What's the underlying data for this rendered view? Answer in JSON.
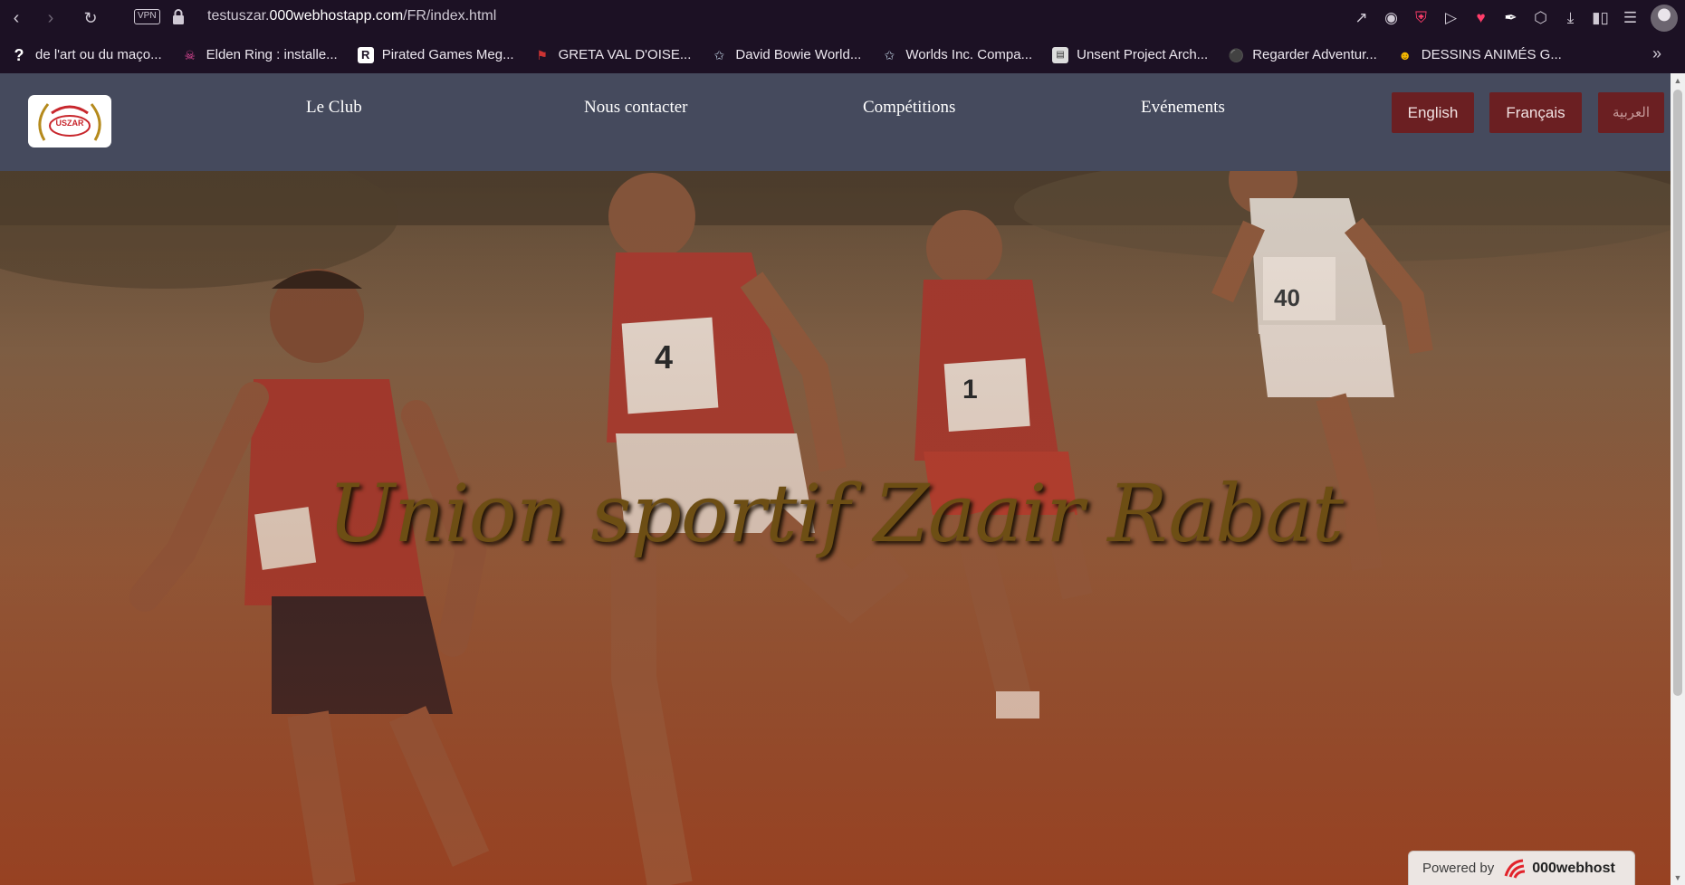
{
  "browser": {
    "url_prefix": "testuszar.",
    "url_domain": "000webhostapp.com",
    "url_path": "/FR/index.html",
    "vpn_label": "VPN",
    "toolbar_icons": [
      "share-icon",
      "camera-icon",
      "shield-icon",
      "send-icon",
      "heart-icon",
      "pen-icon",
      "box-icon",
      "download-icon",
      "battery-icon",
      "menu-icon"
    ]
  },
  "bookmarks": [
    {
      "label": "de l'art ou du maço...",
      "icon": "question-icon"
    },
    {
      "label": "Elden Ring : installe...",
      "icon": "skull-icon"
    },
    {
      "label": "Pirated Games Meg...",
      "icon": "r-icon"
    },
    {
      "label": "GRETA VAL D'OISE...",
      "icon": "school-icon"
    },
    {
      "label": "David Bowie World...",
      "icon": "feather-icon"
    },
    {
      "label": "Worlds Inc. Compa...",
      "icon": "feather-icon"
    },
    {
      "label": "Unsent Project Arch...",
      "icon": "doc-icon"
    },
    {
      "label": "Regarder Adventur...",
      "icon": "bottle-icon"
    },
    {
      "label": "DESSINS ANIMÉS G...",
      "icon": "emoji-icon"
    }
  ],
  "site": {
    "logo_text": "USZAR",
    "nav": [
      "Le Club",
      "Nous contacter",
      "Compétitions",
      "Evénements"
    ],
    "languages": [
      "English",
      "Français",
      "العربية"
    ],
    "hero_title": "Union sportif Zaair Rabat",
    "bib_numbers": [
      "4",
      "1",
      "40"
    ],
    "footer_powered": "Powered by",
    "footer_brand": "000webhost"
  },
  "colors": {
    "nav_bg": "#454a5d",
    "lang_button_bg": "#6b1f22",
    "title_color": "#6d4e14",
    "chrome_bg": "#1c1124"
  }
}
